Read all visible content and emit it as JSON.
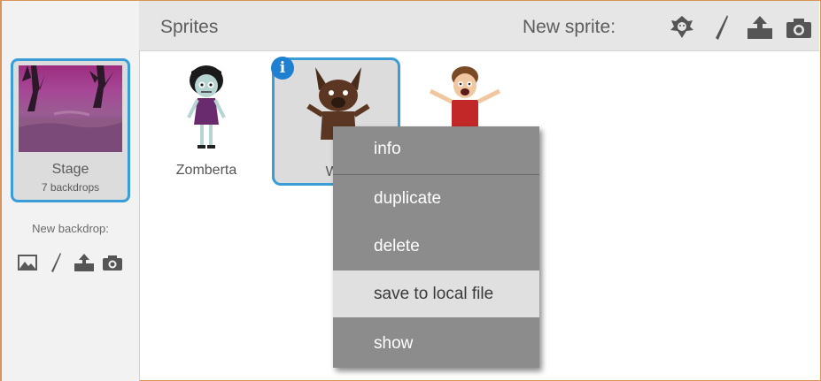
{
  "stage": {
    "name": "Stage",
    "backdrops": "7 backdrops",
    "new_backdrop_label": "New backdrop:",
    "backdrop_icons": [
      "image-icon",
      "paintbrush-icon",
      "upload-icon",
      "camera-icon"
    ]
  },
  "header": {
    "title": "Sprites",
    "new_sprite_label": "New sprite:",
    "new_sprite_icons": [
      "sprite-library-icon",
      "paintbrush-icon",
      "upload-icon",
      "camera-icon"
    ]
  },
  "sprites": [
    {
      "name": "Zomberta",
      "selected": false
    },
    {
      "name": "Wo",
      "selected": true
    },
    {
      "name": "",
      "selected": false
    }
  ],
  "info_badge": "i",
  "context_menu": {
    "items": [
      {
        "label": "info",
        "highlighted": false
      },
      {
        "label": "duplicate",
        "highlighted": false
      },
      {
        "label": "delete",
        "highlighted": false
      },
      {
        "label": "save to local file",
        "highlighted": true
      },
      {
        "label": "show",
        "highlighted": false
      }
    ]
  },
  "colors": {
    "selection": "#3a9dd8",
    "menu_bg": "#8c8c8c",
    "menu_highlight": "#e0e0e0",
    "info_badge": "#1f7fd0"
  }
}
